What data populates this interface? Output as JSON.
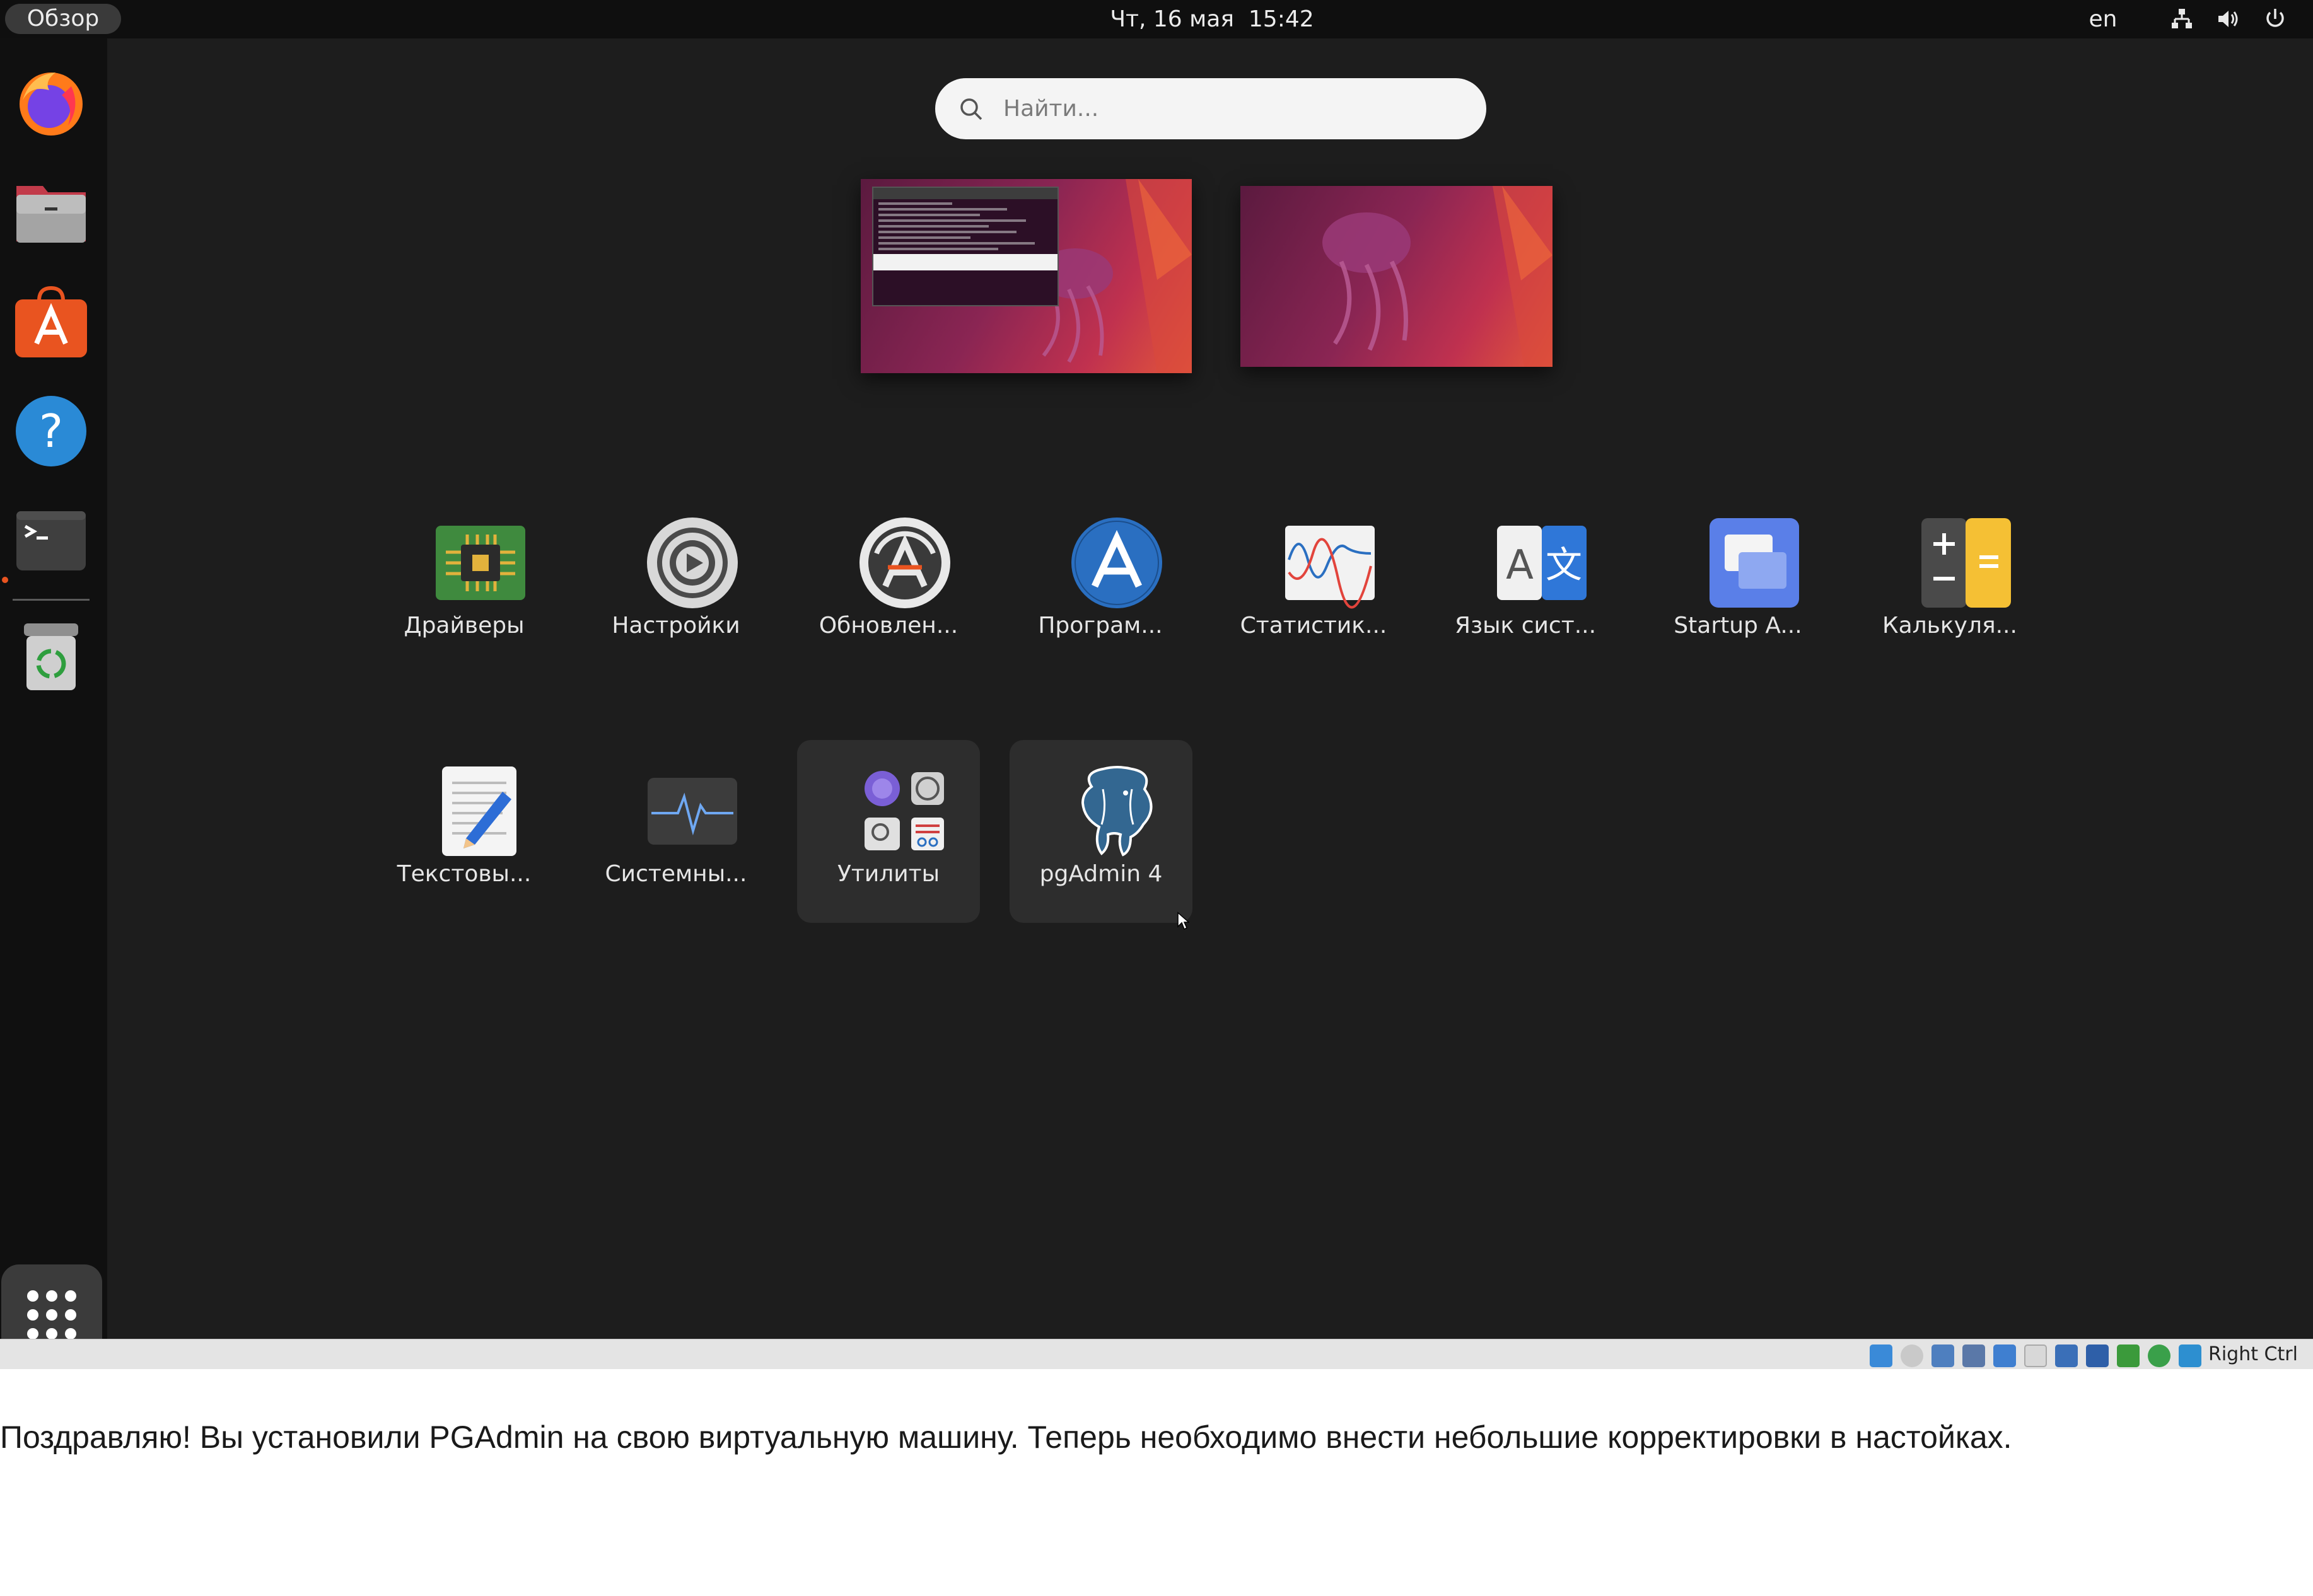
{
  "topbar": {
    "activities": "Обзор",
    "clock": "Чт, 16 мая  15:42",
    "language": "en",
    "tray_icons": [
      "network-icon",
      "volume-icon",
      "power-icon"
    ]
  },
  "dock": {
    "items": [
      "firefox-icon",
      "files-icon",
      "app-center-icon",
      "help-icon",
      "terminal-icon",
      "trash-icon"
    ],
    "show_apps": "show-apps-grid-icon"
  },
  "search": {
    "placeholder": "Найти..."
  },
  "apps": [
    {
      "label": "Драйверы",
      "icon": "drivers-chip-icon"
    },
    {
      "label": "Настройки",
      "icon": "settings-gear-icon"
    },
    {
      "label": "Обновлен...",
      "icon": "software-updater-icon"
    },
    {
      "label": "Програм...",
      "icon": "software-properties-icon"
    },
    {
      "label": "Статистик...",
      "icon": "power-statistics-icon"
    },
    {
      "label": "Язык сист...",
      "icon": "language-support-icon"
    },
    {
      "label": "Startup A...",
      "icon": "startup-applications-icon"
    },
    {
      "label": "Калькуля...",
      "icon": "calculator-icon"
    },
    {
      "label": "Текстовы...",
      "icon": "text-editor-icon"
    },
    {
      "label": "Системны...",
      "icon": "system-monitor-icon"
    },
    {
      "label": "Утилиты",
      "icon": "utilities-folder-icon"
    },
    {
      "label": "pgAdmin 4",
      "icon": "pgadmin-elephant-icon"
    }
  ],
  "vbox_status": {
    "host_key": "Right Ctrl"
  },
  "caption": "Поздравляю! Вы установили PGAdmin на свою виртуальную машину. Теперь необходимо внести небольшие корректировки в настойках.",
  "colors": {
    "desktop_bg": "#1d1d1d",
    "topbar_bg": "#0f0f0f",
    "dock_bg": "#101010",
    "accent_orange": "#e95420"
  }
}
